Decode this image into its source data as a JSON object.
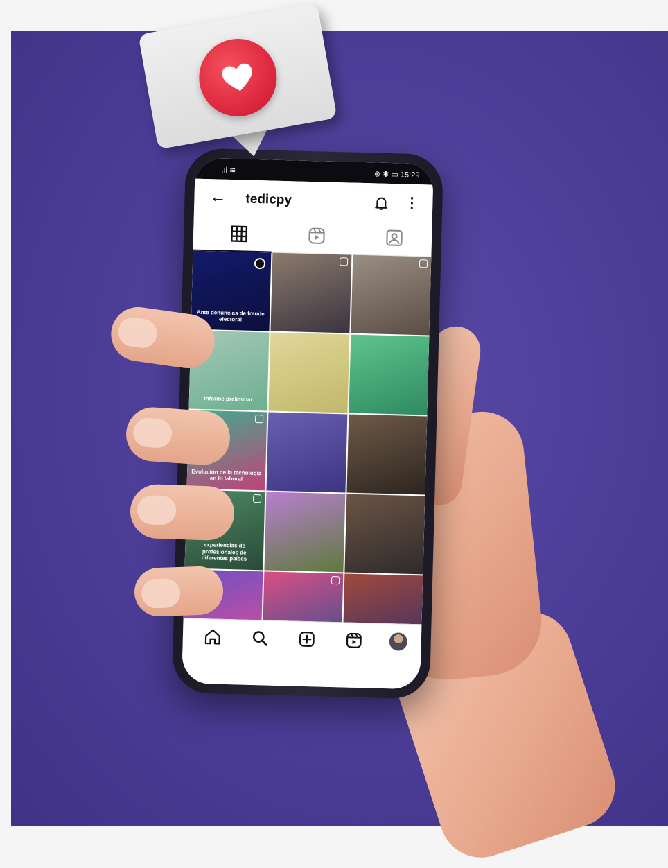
{
  "status_bar": {
    "left": ".ıl ≋",
    "right": "⊛ ✱ ▭ 15:29"
  },
  "app_bar": {
    "back": "←",
    "username": "tedicpy",
    "more": "⋮"
  },
  "tabs": [
    "grid-icon",
    "reels-icon",
    "tagged-icon"
  ],
  "grid_posts": [
    {
      "caption": "Ante denuncias de fraude electoral",
      "colors": [
        "#141a6b",
        "#0b0f3d"
      ]
    },
    {
      "caption": "",
      "colors": [
        "#8b7b6d",
        "#3b3440"
      ]
    },
    {
      "caption": "",
      "colors": [
        "#9a8f84",
        "#5b4d45"
      ]
    },
    {
      "caption": "Informe preliminar",
      "colors": [
        "#a5c8b7",
        "#6cb08f"
      ]
    },
    {
      "caption": "",
      "colors": [
        "#e2d79a",
        "#c0b86a"
      ]
    },
    {
      "caption": "",
      "colors": [
        "#5fc48e",
        "#2f8a60"
      ]
    },
    {
      "caption": "Evolución de la tecnología en lo laboral",
      "colors": [
        "#3fae8d",
        "#c2417a"
      ]
    },
    {
      "caption": "",
      "colors": [
        "#6a5fb0",
        "#3c3582"
      ]
    },
    {
      "caption": "",
      "colors": [
        "#6e5a48",
        "#2d2520"
      ]
    },
    {
      "caption": "experiencias de profesionales de diferentes países",
      "colors": [
        "#4d8a64",
        "#2a4a38"
      ]
    },
    {
      "caption": "",
      "colors": [
        "#b87fd0",
        "#5e7a3c"
      ]
    },
    {
      "caption": "",
      "colors": [
        "#6b5546",
        "#2f2a2a"
      ]
    },
    {
      "caption": "",
      "colors": [
        "#6b51c4",
        "#d94d9a"
      ]
    },
    {
      "caption": "",
      "colors": [
        "#d94f85",
        "#3b4f8f"
      ]
    },
    {
      "caption": "",
      "colors": [
        "#a14a3a",
        "#3a2e6a"
      ]
    }
  ],
  "bottom_nav": [
    "home-icon",
    "search-icon",
    "create-icon",
    "reels-icon",
    "profile-avatar"
  ],
  "notification": {
    "icon": "heart-icon",
    "accent": "#e8283f"
  },
  "colors": {
    "background": "#4a3c95",
    "bubble": "#e4e4e4"
  }
}
